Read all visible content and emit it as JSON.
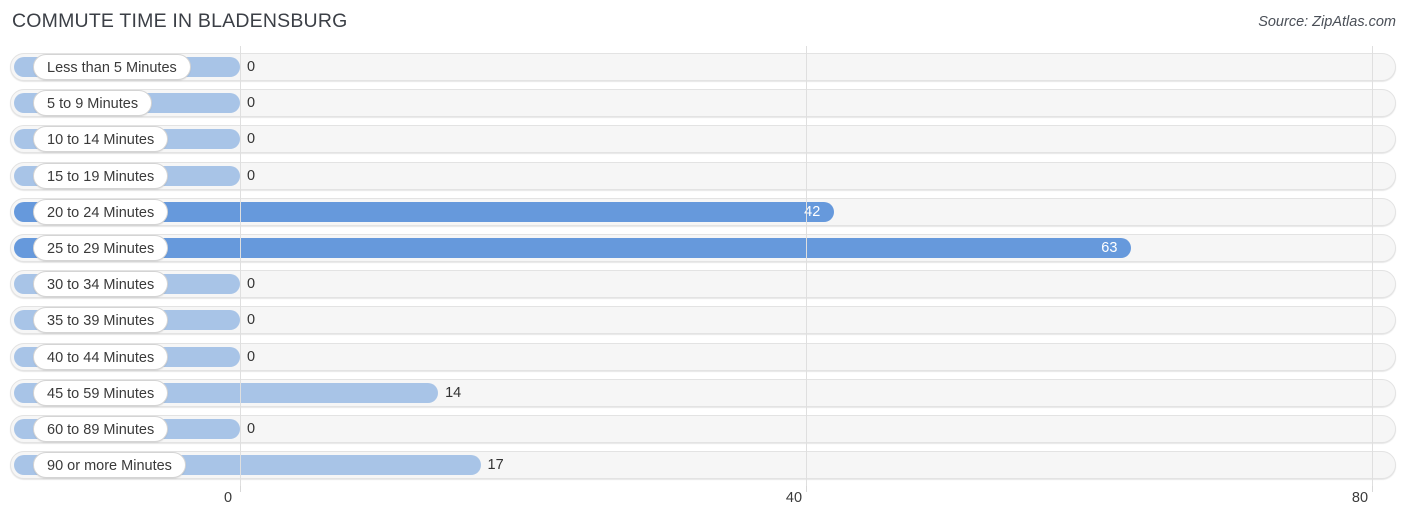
{
  "header": {
    "title": "COMMUTE TIME IN BLADENSBURG",
    "source": "Source: ZipAtlas.com"
  },
  "colors": {
    "bar_light": "#a8c4e7",
    "bar_strong": "#6699dc",
    "track": "#f6f6f6",
    "gridline": "#dfdfdf",
    "text": "#333333"
  },
  "chart_data": {
    "type": "bar",
    "orientation": "horizontal",
    "title": "COMMUTE TIME IN BLADENSBURG",
    "xlabel": "",
    "ylabel": "",
    "xlim": [
      0,
      80
    ],
    "ticks": [
      "0",
      "40",
      "80"
    ],
    "tick_values": [
      0,
      40,
      80
    ],
    "grid": true,
    "legend": false,
    "categories": [
      "Less than 5 Minutes",
      "5 to 9 Minutes",
      "10 to 14 Minutes",
      "15 to 19 Minutes",
      "20 to 24 Minutes",
      "25 to 29 Minutes",
      "30 to 34 Minutes",
      "35 to 39 Minutes",
      "40 to 44 Minutes",
      "45 to 59 Minutes",
      "60 to 89 Minutes",
      "90 or more Minutes"
    ],
    "values": [
      0,
      0,
      0,
      0,
      42,
      63,
      0,
      0,
      0,
      14,
      0,
      17
    ],
    "value_labels": [
      "0",
      "0",
      "0",
      "0",
      "42",
      "63",
      "0",
      "0",
      "0",
      "14",
      "0",
      "17"
    ]
  }
}
